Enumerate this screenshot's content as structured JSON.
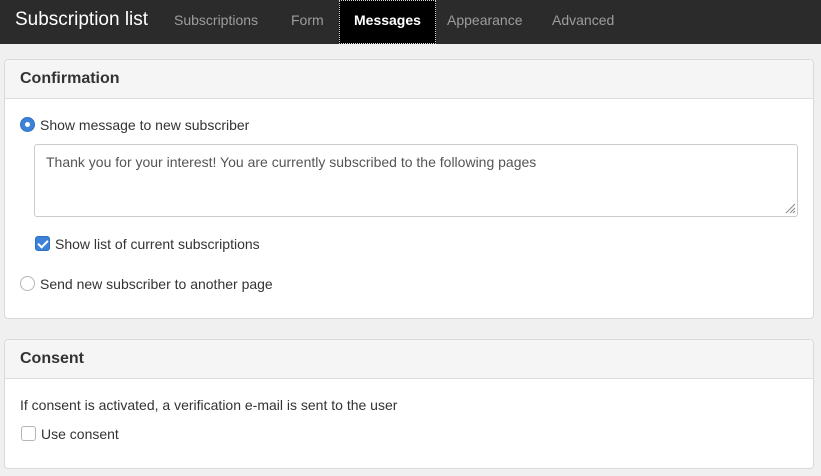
{
  "navbar": {
    "brand": "Subscription list",
    "tabs": [
      {
        "label": "Subscriptions",
        "active": false
      },
      {
        "label": "Form",
        "active": false
      },
      {
        "label": "Messages",
        "active": true
      },
      {
        "label": "Appearance",
        "active": false
      },
      {
        "label": "Advanced",
        "active": false
      }
    ]
  },
  "confirmation": {
    "title": "Confirmation",
    "option_show_message": {
      "label": "Show message to new subscriber",
      "selected": true
    },
    "message_value": "Thank you for your interest! You are currently subscribed to the following pages",
    "show_list": {
      "label": "Show list of current subscriptions",
      "checked": true
    },
    "option_redirect": {
      "label": "Send new subscriber to another page",
      "selected": false
    }
  },
  "consent": {
    "title": "Consent",
    "description": "If consent is activated, a verification e-mail is sent to the user",
    "use_consent": {
      "label": "Use consent",
      "checked": false
    }
  },
  "colors": {
    "navbar_bg": "#2b2b2b",
    "active_tab_bg": "#000000",
    "accent": "#3b82d8",
    "page_bg": "#f0f0f0"
  }
}
